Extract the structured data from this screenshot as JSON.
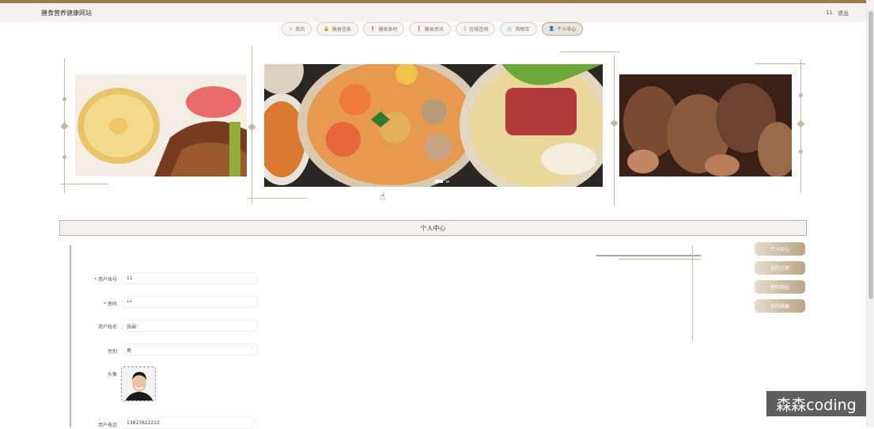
{
  "header": {
    "site_title": "膳食营养健康网站",
    "user_id": "11",
    "logout_label": "退出"
  },
  "nav": [
    {
      "icon": "☆",
      "icon_name": "star-icon",
      "label": "首页"
    },
    {
      "icon": "🔒",
      "icon_name": "lock-icon",
      "label": "膳食信息"
    },
    {
      "icon": "❗",
      "icon_name": "info-icon",
      "label": "膳食食材"
    },
    {
      "icon": "❗",
      "icon_name": "info-icon",
      "label": "膳食资讯"
    },
    {
      "icon": "♫",
      "icon_name": "chat-icon",
      "label": "在线咨询"
    },
    {
      "icon": "🛒",
      "icon_name": "cart-icon",
      "label": "购物车"
    },
    {
      "icon": "👤",
      "icon_name": "user-icon",
      "label": "个人中心"
    }
  ],
  "section_title": "个人中心",
  "form": {
    "account_label": "* 用户账号",
    "account_value": "11",
    "password_label": "* 密码",
    "password_value": "••",
    "name_label": "用户姓名",
    "name_value": "张阑",
    "gender_label": "性别",
    "gender_value": "男",
    "avatar_label": "头像",
    "phone_label": "用户电话",
    "phone_value": "13823822222"
  },
  "side_menu": [
    "个人中心",
    "我的订单",
    "我的地址",
    "我的收藏"
  ],
  "watermark": "森森coding",
  "colors": {
    "accent": "#9c7a4c",
    "side_button": "#b9a588"
  }
}
